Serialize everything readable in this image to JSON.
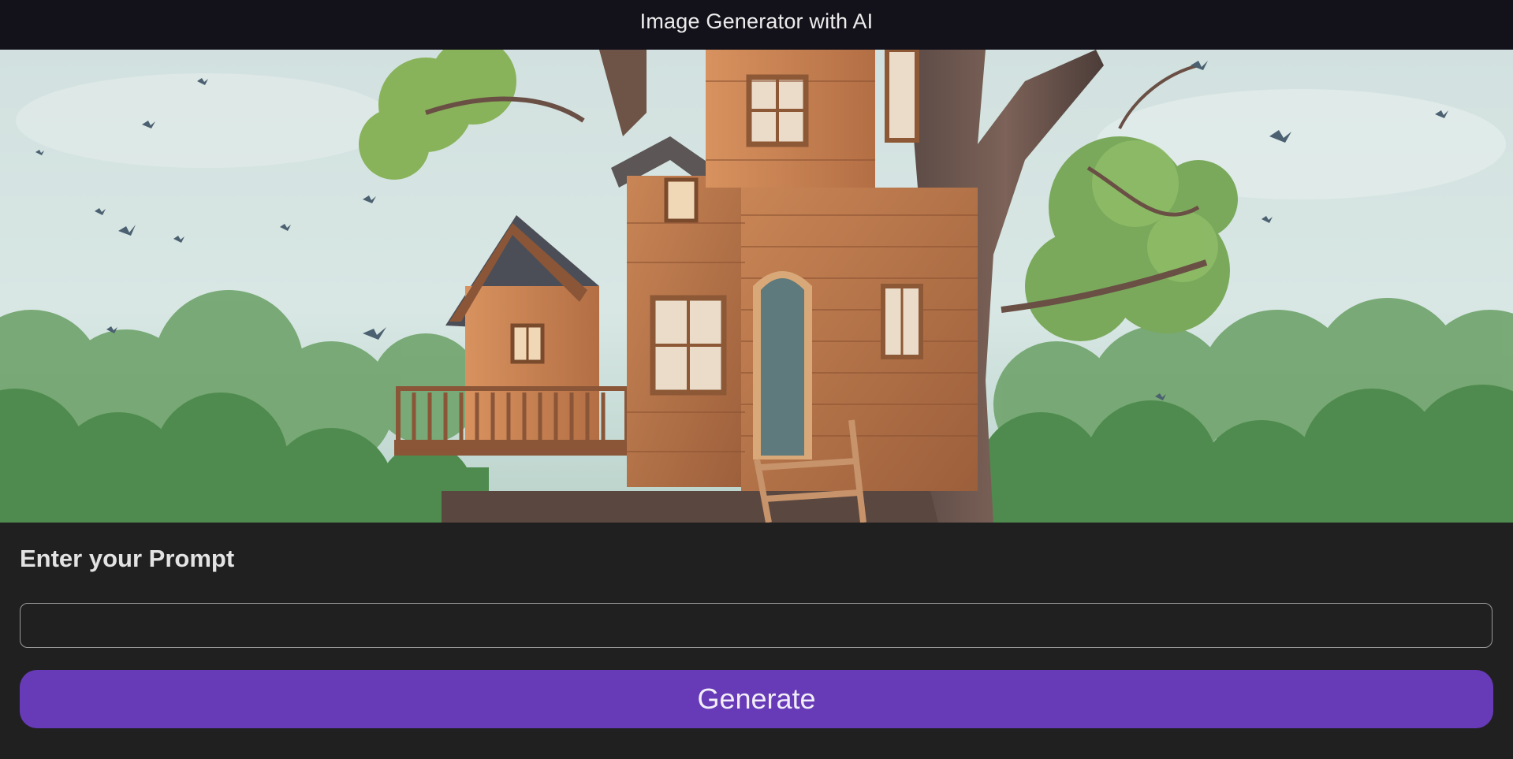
{
  "header": {
    "title": "Image Generator with AI"
  },
  "hero": {
    "icon": "treehouse-image"
  },
  "form": {
    "prompt_label": "Enter your Prompt",
    "prompt_value": "",
    "prompt_placeholder": "",
    "generate_label": "Generate"
  },
  "colors": {
    "topbar": "#13111a",
    "background": "#202020",
    "accent": "#673ab7",
    "text": "#e3e3e3"
  }
}
